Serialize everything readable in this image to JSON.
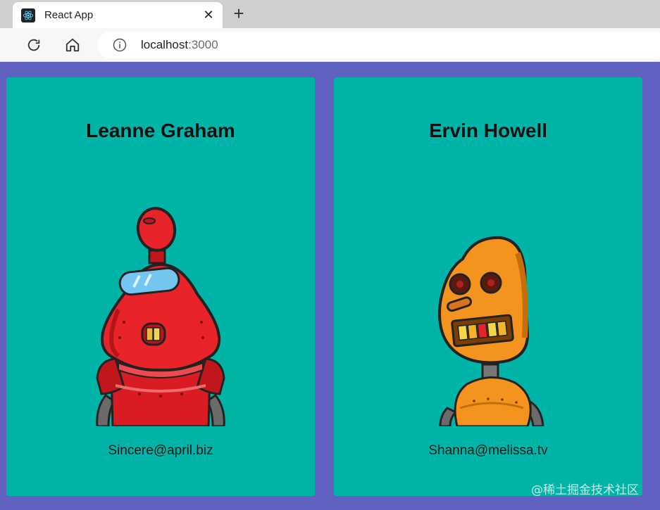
{
  "browser": {
    "tab": {
      "title": "React App",
      "icon": "react-logo-icon",
      "close_glyph": "✕"
    },
    "new_tab_glyph": "+",
    "toolbar": {
      "reload_icon": "reload-icon",
      "home_icon": "home-icon"
    },
    "address_bar": {
      "info_icon": "info-icon",
      "host": "localhost",
      "port": ":3000"
    }
  },
  "cards": [
    {
      "name": "Leanne Graham",
      "email": "Sincere@april.biz",
      "avatar": "red-robot-avatar"
    },
    {
      "name": "Ervin Howell",
      "email": "Shanna@melissa.tv",
      "avatar": "orange-robot-avatar"
    }
  ],
  "watermark": "@稀土掘金技术社区",
  "colors": {
    "page_background": "#6161c1",
    "card_background": "#00b5a7",
    "tabbar": "#cfcfcf",
    "robot_red": "#e8232a",
    "robot_orange": "#f4941f"
  }
}
